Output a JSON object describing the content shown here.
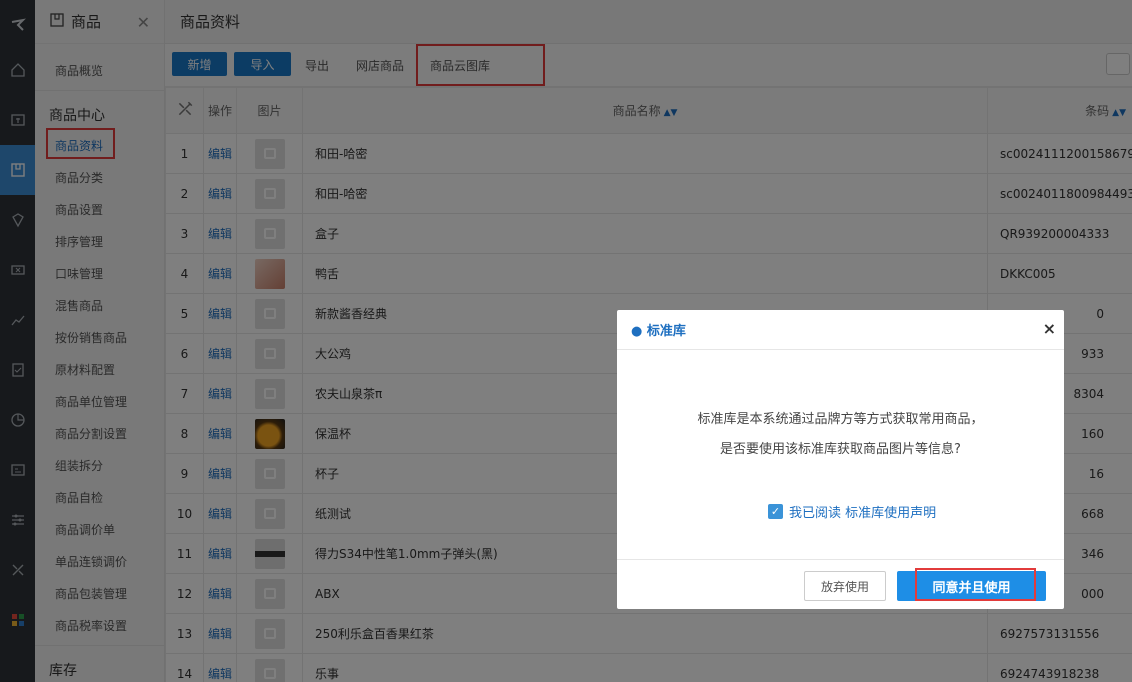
{
  "sidebar": {
    "title": "商品",
    "overview": "商品概览",
    "section_center": "商品中心",
    "items": [
      "商品资料",
      "商品分类",
      "商品设置",
      "排序管理",
      "口味管理",
      "混售商品",
      "按份销售商品",
      "原材料配置",
      "商品单位管理",
      "商品分割设置",
      "组装拆分",
      "商品自检",
      "商品调价单",
      "单品连锁调价",
      "商品包装管理",
      "商品税率设置"
    ],
    "section_stock": "库存"
  },
  "main": {
    "title": "商品资料",
    "toolbar": {
      "new": "新增",
      "import": "导入",
      "export": "导出",
      "shop_goods": "网店商品",
      "cloud_gallery": "商品云图库"
    },
    "table": {
      "headers": {
        "action": "操作",
        "image": "图片",
        "name": "商品名称",
        "barcode": "条码"
      },
      "edit_label": "编辑",
      "rows": [
        {
          "no": "1",
          "name": "和田-哈密",
          "code": "sc0024111200158679",
          "img": "placeholder"
        },
        {
          "no": "2",
          "name": "和田-哈密",
          "code": "sc0024011800984493",
          "img": "placeholder"
        },
        {
          "no": "3",
          "name": "盒子",
          "code": "QR939200004333",
          "img": "placeholder"
        },
        {
          "no": "4",
          "name": "鸭舌",
          "code": "DKKC005",
          "img": "food"
        },
        {
          "no": "5",
          "name": "新款酱香经典",
          "code": "0",
          "img": "placeholder"
        },
        {
          "no": "6",
          "name": "大公鸡",
          "code": "933",
          "img": "placeholder"
        },
        {
          "no": "7",
          "name": "农夫山泉茶π",
          "code": "8304",
          "img": "placeholder"
        },
        {
          "no": "8",
          "name": "保温杯",
          "code": "160",
          "img": "orange"
        },
        {
          "no": "9",
          "name": "杯子",
          "code": "16",
          "img": "placeholder"
        },
        {
          "no": "10",
          "name": "纸测试",
          "code": "668",
          "img": "placeholder"
        },
        {
          "no": "11",
          "name": "得力S34中性笔1.0mm子弹头(黑)",
          "code": "346",
          "img": "pen"
        },
        {
          "no": "12",
          "name": "ABX",
          "code": "000",
          "img": "placeholder"
        },
        {
          "no": "13",
          "name": "250利乐盒百香果红茶",
          "code": "6927573131556",
          "img": "placeholder"
        },
        {
          "no": "14",
          "name": "乐事",
          "code": "6924743918238",
          "img": "placeholder"
        }
      ]
    }
  },
  "modal": {
    "title": "● 标准库",
    "close": "×",
    "line1": "标准库是本系统通过品牌方等方式获取常用商品，",
    "line2": "是否要使用该标准库获取商品图片等信息?",
    "checkbox_label": "我已阅读 标准库使用声明",
    "cancel": "放弃使用",
    "confirm": "同意并且使用"
  },
  "colors": {
    "primary": "#1878c9",
    "highlight": "#e23b3b"
  }
}
